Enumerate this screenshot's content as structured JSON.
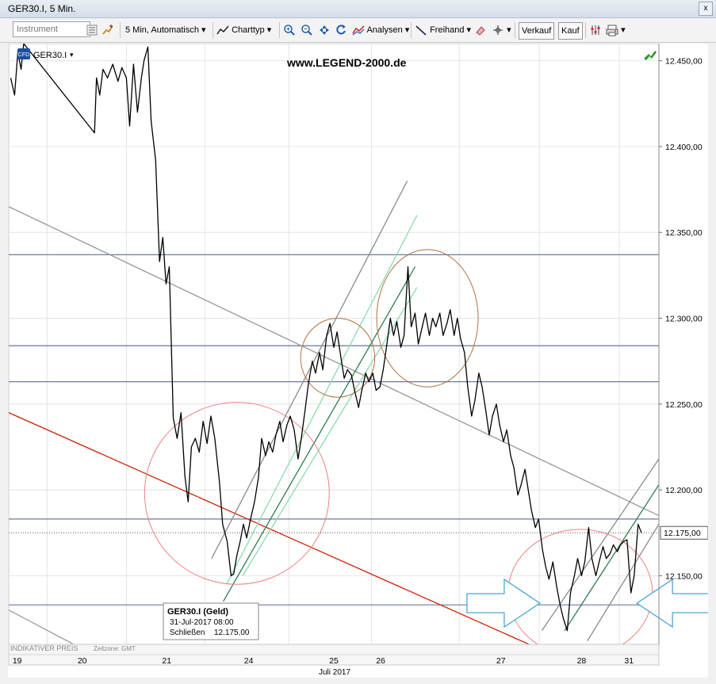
{
  "window": {
    "title": "GER30.I, 5 Min.",
    "close_glyph": "x"
  },
  "toolbar": {
    "instrument_placeholder": "Instrument",
    "interval_label": "5 Min,",
    "auto_label": "Automatisch",
    "charttype_label": "Charttyp",
    "analysis_label": "Analysen",
    "freehand_label": "Freihand",
    "sell_label": "Verkauf",
    "buy_label": "Kauf",
    "dropdown_glyph": "▾"
  },
  "chart_data": {
    "type": "line",
    "title": "www.LEGEND-2000.de",
    "instrument_label": "GER30.I",
    "xlabel": "Juli 2017",
    "footer_left": "INDIKATIVER PREIS",
    "footer_tz": "Zeitzone: GMT",
    "ylim": [
      12110,
      12460
    ],
    "yticks": [
      12150,
      12200,
      12250,
      12300,
      12350,
      12400,
      12450
    ],
    "ytick_labels": [
      "12.150,00",
      "12.200,00",
      "12.250,00",
      "12.300,00",
      "12.350,00",
      "12.400,00",
      "12.450,00"
    ],
    "current_value": 12175,
    "current_label": "12.175,00",
    "xlim": [
      0,
      100
    ],
    "xticks": [
      {
        "x": 1.3,
        "label": "19"
      },
      {
        "x": 11.3,
        "label": "20"
      },
      {
        "x": 24.3,
        "label": "21"
      },
      {
        "x": 36.9,
        "label": "24"
      },
      {
        "x": 50.0,
        "label": "25"
      },
      {
        "x": 57.2,
        "label": "26"
      },
      {
        "x": 75.7,
        "label": "27"
      },
      {
        "x": 88.1,
        "label": "28"
      },
      {
        "x": 95.4,
        "label": "31"
      }
    ],
    "day_boundaries": [
      5.9,
      18.1,
      30.2,
      43.1,
      55.8,
      69.3,
      81.6,
      93.9
    ],
    "series": [
      {
        "color": "#000000",
        "points": [
          [
            0.3,
            12440
          ],
          [
            0.9,
            12430
          ],
          [
            1.4,
            12455
          ],
          [
            1.9,
            12445
          ],
          [
            2.3,
            12460
          ],
          [
            13.2,
            12408
          ],
          [
            13.5,
            12440
          ],
          [
            14.0,
            12430
          ],
          [
            14.5,
            12445
          ],
          [
            15.2,
            12440
          ],
          [
            16.0,
            12448
          ],
          [
            16.8,
            12438
          ],
          [
            17.4,
            12446
          ],
          [
            18.1,
            12440
          ],
          [
            18.6,
            12412
          ],
          [
            19.2,
            12448
          ],
          [
            19.8,
            12420
          ],
          [
            20.4,
            12440
          ],
          [
            20.8,
            12450
          ],
          [
            21.4,
            12458
          ],
          [
            21.9,
            12415
          ],
          [
            22.6,
            12392
          ],
          [
            23.2,
            12333
          ],
          [
            23.7,
            12347
          ],
          [
            24.2,
            12320
          ],
          [
            24.7,
            12330
          ],
          [
            25.3,
            12242
          ],
          [
            25.9,
            12230
          ],
          [
            26.5,
            12245
          ],
          [
            27.1,
            12208
          ],
          [
            27.6,
            12193
          ],
          [
            28.1,
            12225
          ],
          [
            28.7,
            12230
          ],
          [
            29.3,
            12222
          ],
          [
            29.9,
            12240
          ],
          [
            30.5,
            12227
          ],
          [
            31.1,
            12243
          ],
          [
            31.7,
            12230
          ],
          [
            32.4,
            12205
          ],
          [
            32.9,
            12180
          ],
          [
            33.6,
            12170
          ],
          [
            34.2,
            12150
          ],
          [
            34.6,
            12151
          ],
          [
            35.1,
            12162
          ],
          [
            35.6,
            12170
          ],
          [
            36.1,
            12180
          ],
          [
            36.6,
            12172
          ],
          [
            37.2,
            12183
          ],
          [
            37.8,
            12193
          ],
          [
            38.4,
            12207
          ],
          [
            38.9,
            12230
          ],
          [
            39.5,
            12220
          ],
          [
            40.0,
            12228
          ],
          [
            40.6,
            12222
          ],
          [
            41.1,
            12232
          ],
          [
            41.7,
            12240
          ],
          [
            42.2,
            12228
          ],
          [
            42.8,
            12238
          ],
          [
            43.3,
            12243
          ],
          [
            43.9,
            12235
          ],
          [
            44.5,
            12218
          ],
          [
            45.0,
            12230
          ],
          [
            45.6,
            12247
          ],
          [
            46.1,
            12262
          ],
          [
            46.7,
            12275
          ],
          [
            47.2,
            12268
          ],
          [
            47.8,
            12280
          ],
          [
            48.3,
            12270
          ],
          [
            48.9,
            12290
          ],
          [
            49.4,
            12297
          ],
          [
            50.0,
            12283
          ],
          [
            50.5,
            12292
          ],
          [
            51.1,
            12277
          ],
          [
            51.6,
            12265
          ],
          [
            52.1,
            12270
          ],
          [
            52.7,
            12267
          ],
          [
            53.2,
            12258
          ],
          [
            53.8,
            12248
          ],
          [
            54.3,
            12258
          ],
          [
            54.9,
            12268
          ],
          [
            55.4,
            12263
          ],
          [
            56.0,
            12268
          ],
          [
            56.5,
            12258
          ],
          [
            57.1,
            12260
          ],
          [
            57.6,
            12270
          ],
          [
            58.1,
            12283
          ],
          [
            58.7,
            12300
          ],
          [
            59.2,
            12290
          ],
          [
            59.7,
            12298
          ],
          [
            60.3,
            12283
          ],
          [
            60.8,
            12290
          ],
          [
            61.4,
            12330
          ],
          [
            61.9,
            12295
          ],
          [
            62.5,
            12303
          ],
          [
            63.0,
            12285
          ],
          [
            63.6,
            12295
          ],
          [
            64.1,
            12303
          ],
          [
            64.7,
            12290
          ],
          [
            65.2,
            12300
          ],
          [
            65.7,
            12295
          ],
          [
            66.3,
            12303
          ],
          [
            66.8,
            12290
          ],
          [
            67.4,
            12297
          ],
          [
            67.9,
            12305
          ],
          [
            68.5,
            12290
          ],
          [
            69.0,
            12300
          ],
          [
            69.5,
            12288
          ],
          [
            70.1,
            12280
          ],
          [
            70.6,
            12260
          ],
          [
            71.2,
            12243
          ],
          [
            71.7,
            12252
          ],
          [
            72.3,
            12268
          ],
          [
            72.8,
            12260
          ],
          [
            73.3,
            12248
          ],
          [
            73.9,
            12232
          ],
          [
            74.4,
            12243
          ],
          [
            75.0,
            12250
          ],
          [
            75.5,
            12238
          ],
          [
            76.1,
            12228
          ],
          [
            76.6,
            12235
          ],
          [
            77.2,
            12220
          ],
          [
            77.7,
            12213
          ],
          [
            78.3,
            12197
          ],
          [
            78.8,
            12203
          ],
          [
            79.4,
            12212
          ],
          [
            79.9,
            12200
          ],
          [
            80.4,
            12188
          ],
          [
            81.0,
            12178
          ],
          [
            81.5,
            12183
          ],
          [
            82.1,
            12165
          ],
          [
            82.6,
            12155
          ],
          [
            83.1,
            12148
          ],
          [
            83.7,
            12158
          ],
          [
            84.3,
            12143
          ],
          [
            84.8,
            12133
          ],
          [
            85.3,
            12125
          ],
          [
            85.9,
            12118
          ],
          [
            86.4,
            12140
          ],
          [
            87.0,
            12150
          ],
          [
            87.5,
            12160
          ],
          [
            88.1,
            12150
          ],
          [
            88.6,
            12158
          ],
          [
            89.2,
            12178
          ],
          [
            89.7,
            12160
          ],
          [
            90.3,
            12150
          ],
          [
            90.8,
            12158
          ],
          [
            91.4,
            12167
          ],
          [
            91.9,
            12160
          ],
          [
            92.5,
            12163
          ],
          [
            93.0,
            12168
          ],
          [
            93.6,
            12164
          ],
          [
            94.1,
            12168
          ],
          [
            94.6,
            12170
          ],
          [
            95.1,
            12171
          ],
          [
            95.7,
            12140
          ],
          [
            96.2,
            12150
          ],
          [
            96.8,
            12180
          ],
          [
            97.3,
            12175
          ]
        ]
      }
    ],
    "horizontal_lines": [
      {
        "y": 12337,
        "color": "#6a7aa0"
      },
      {
        "y": 12284,
        "color": "#556688"
      },
      {
        "y": 12263,
        "color": "#6a7aa0"
      },
      {
        "y": 12183,
        "color": "#6a7aa0"
      },
      {
        "y": 12133,
        "color": "#6a7aa0"
      }
    ],
    "trend_lines": [
      {
        "from": [
          0,
          12365
        ],
        "to": [
          100,
          12185
        ],
        "color": "#9a9a9a"
      },
      {
        "from": [
          0,
          12245
        ],
        "to": [
          83,
          12105
        ],
        "color": "#cc2200"
      },
      {
        "from": [
          0,
          12130
        ],
        "to": [
          20,
          12090
        ],
        "color": "#9a9a9a"
      },
      {
        "from": [
          31.2,
          12160
        ],
        "to": [
          61.3,
          12380
        ],
        "color": "#8a8a8a"
      },
      {
        "from": [
          33.0,
          12135
        ],
        "to": [
          62.5,
          12330
        ],
        "color": "#2e7d4f"
      },
      {
        "from": [
          33.5,
          12145
        ],
        "to": [
          62.8,
          12360
        ],
        "color": "#88ddaa"
      },
      {
        "from": [
          36.0,
          12150
        ],
        "to": [
          62.8,
          12318
        ],
        "color": "#88ddaa"
      },
      {
        "from": [
          82.0,
          12118
        ],
        "to": [
          100,
          12218
        ],
        "color": "#8a8a8a"
      },
      {
        "from": [
          85.5,
          12118
        ],
        "to": [
          100,
          12203
        ],
        "color": "#2e7d4f"
      },
      {
        "from": [
          89.0,
          12112
        ],
        "to": [
          100,
          12180
        ],
        "color": "#8a8a8a"
      }
    ],
    "ellipses": [
      {
        "cx": 35.1,
        "cy": 12198,
        "rx": 14.2,
        "ry": 53,
        "color": "#f08080"
      },
      {
        "cx": 50.6,
        "cy": 12277,
        "rx": 5.7,
        "ry": 23,
        "color": "#b07040"
      },
      {
        "cx": 64.4,
        "cy": 12300,
        "rx": 7.8,
        "ry": 40,
        "color": "#b07040"
      },
      {
        "cx": 87.9,
        "cy": 12140,
        "rx": 11.1,
        "ry": 37,
        "color": "#f08080"
      }
    ],
    "arrows": [
      {
        "tip": [
          81.7,
          12134
        ],
        "dir": "right",
        "color": "#4aa8d8"
      },
      {
        "tip": [
          96.6,
          12134
        ],
        "dir": "left",
        "color": "#4aa8d8"
      }
    ],
    "tooltip": {
      "title": "GER30.I (Geld)",
      "date": "31-Jul-2017 08:00",
      "close_label": "Schließen",
      "close_value": "12.175,00"
    }
  }
}
